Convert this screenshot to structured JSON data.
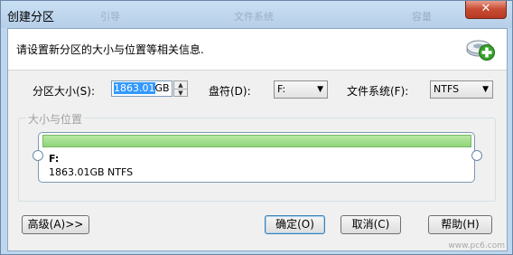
{
  "window": {
    "title": "创建分区",
    "close_label": "✕",
    "background_ghost_text": [
      "引导",
      "文件系统",
      "容量"
    ]
  },
  "header": {
    "text": "请设置新分区的大小与位置等相关信息.",
    "icon": "add-partition-icon"
  },
  "form": {
    "size_label": "分区大小(S):",
    "size_value_selected": "1863.01",
    "size_unit": "GB",
    "drive_label": "盘符(D):",
    "drive_value": "F:",
    "fs_label": "文件系统(F):",
    "fs_value": "NTFS"
  },
  "group": {
    "legend": "大小与位置",
    "drive_letter": "F:",
    "drive_info": "1863.01GB NTFS",
    "bar_fill": 1.0,
    "bar_color": "#9adb85"
  },
  "buttons": {
    "advanced": "高级(A)>>",
    "ok": "确定(O)",
    "cancel": "取消(C)",
    "help": "帮助(H)"
  },
  "watermark": "www.pc6.com"
}
